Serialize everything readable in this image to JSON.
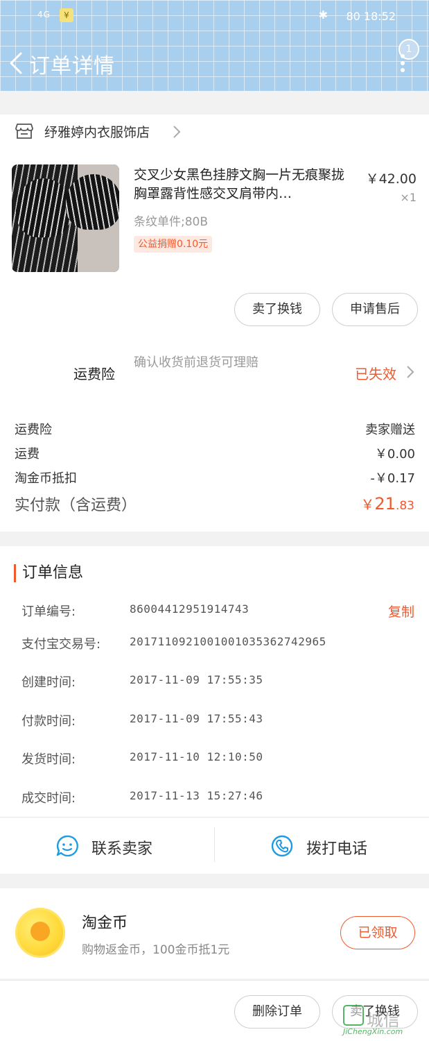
{
  "status_bar": {
    "signal": "4G",
    "yen_badge": "¥",
    "battery": "80",
    "time": "18:52"
  },
  "nav": {
    "title": "订单详情",
    "badge": "1"
  },
  "shop": {
    "name": "纾雅婷内衣服饰店"
  },
  "product": {
    "title": "交叉少女黑色挂脖文胸一片无痕聚拢胸罩露背性感交叉肩带内…",
    "price": "￥42.00",
    "quantity": "×1",
    "spec": "条纹单件;80B",
    "tag": "公益捐赠0.10元"
  },
  "actions": {
    "sell": "卖了换钱",
    "after_sale": "申请售后"
  },
  "insurance": {
    "label": "运费险",
    "desc": "确认收货前退货可理赔",
    "status": "已失效"
  },
  "fees": [
    {
      "label": "运费险",
      "value": "卖家赠送"
    },
    {
      "label": "运费",
      "value": "￥0.00"
    },
    {
      "label": "淘金币抵扣",
      "value": "-￥0.17"
    }
  ],
  "paid": {
    "label": "实付款（含运费）",
    "yen": "￥",
    "integer": "21",
    "decimal": ".83"
  },
  "order_info": {
    "title": "订单信息",
    "copy_label": "复制",
    "rows": [
      {
        "key": "订单编号:",
        "value": "86004412951914743"
      },
      {
        "key": "支付宝交易号:",
        "value": "2017110921001001035362742965"
      },
      {
        "key": "创建时间:",
        "value": "2017-11-09 17:55:35"
      },
      {
        "key": "付款时间:",
        "value": "2017-11-09 17:55:43"
      },
      {
        "key": "发货时间:",
        "value": "2017-11-10 12:10:50"
      },
      {
        "key": "成交时间:",
        "value": "2017-11-13 15:27:46"
      }
    ]
  },
  "contact": {
    "seller": "联系卖家",
    "phone": "拨打电话"
  },
  "coins": {
    "title": "淘金币",
    "desc": "购物返金币，100金币抵1元",
    "button": "已领取"
  },
  "bottom": {
    "delete": "删除订单",
    "sell": "卖了换钱"
  },
  "watermark": {
    "text": "城信",
    "url": "JiChengXin.com"
  },
  "colors": {
    "accent": "#f0592b",
    "header_bg": "#a9cfee",
    "contact_blue": "#1e9be0"
  }
}
